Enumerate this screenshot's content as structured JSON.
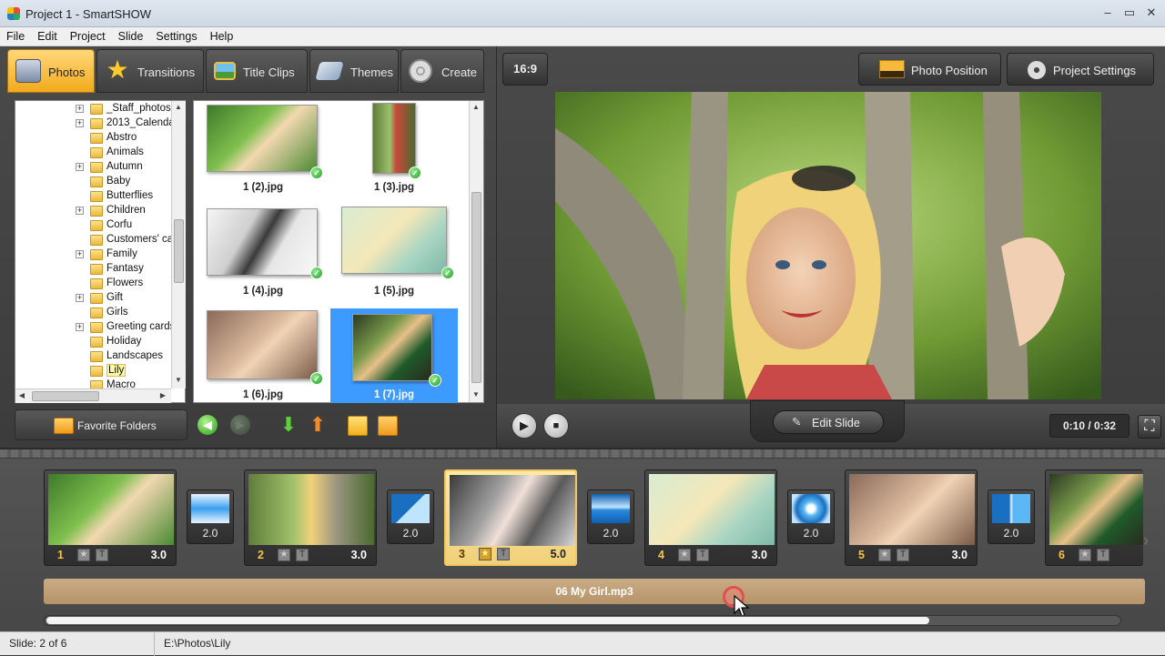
{
  "window": {
    "title": "Project 1 - SmartSHOW",
    "controls": [
      "–",
      "▭",
      "✕"
    ]
  },
  "menu": [
    "File",
    "Edit",
    "Project",
    "Slide",
    "Settings",
    "Help"
  ],
  "tabs": [
    {
      "label": "Photos",
      "icon": "camera-icon",
      "active": true
    },
    {
      "label": "Transitions",
      "icon": "star-icon",
      "active": false
    },
    {
      "label": "Title Clips",
      "icon": "picture-icon",
      "active": false
    },
    {
      "label": "Themes",
      "icon": "themes-icon",
      "active": false
    },
    {
      "label": "Create",
      "icon": "film-reel-icon",
      "active": false
    }
  ],
  "folders": [
    {
      "name": "_Staff_photos",
      "expandable": true
    },
    {
      "name": "2013_Calenda",
      "expandable": true
    },
    {
      "name": "Abstro",
      "expandable": false
    },
    {
      "name": "Animals",
      "expandable": false
    },
    {
      "name": "Autumn",
      "expandable": true
    },
    {
      "name": "Baby",
      "expandable": false
    },
    {
      "name": "Butterflies",
      "expandable": false
    },
    {
      "name": "Children",
      "expandable": true
    },
    {
      "name": "Corfu",
      "expandable": false
    },
    {
      "name": "Customers' cal",
      "expandable": false
    },
    {
      "name": "Family",
      "expandable": true
    },
    {
      "name": "Fantasy",
      "expandable": false
    },
    {
      "name": "Flowers",
      "expandable": false
    },
    {
      "name": "Gift",
      "expandable": true
    },
    {
      "name": "Girls",
      "expandable": false
    },
    {
      "name": "Greeting cards",
      "expandable": true
    },
    {
      "name": "Holiday",
      "expandable": false
    },
    {
      "name": "Landscapes",
      "expandable": false
    },
    {
      "name": "Lily",
      "expandable": false,
      "selected": true
    },
    {
      "name": "Macro",
      "expandable": false
    }
  ],
  "photos": [
    {
      "name": "1 (2).jpg",
      "used": true
    },
    {
      "name": "1 (3).jpg",
      "used": true
    },
    {
      "name": "1 (4).jpg",
      "used": true
    },
    {
      "name": "1 (5).jpg",
      "used": true
    },
    {
      "name": "1 (6).jpg",
      "used": true
    },
    {
      "name": "1 (7).jpg",
      "used": true,
      "selected": true
    }
  ],
  "favorite_folders_label": "Favorite Folders",
  "aspect_ratio": "16:9",
  "photo_position_label": "Photo Position",
  "project_settings_label": "Project Settings",
  "edit_slide_label": "Edit Slide",
  "time_display": "0:10 / 0:32",
  "slides": [
    {
      "num": "1",
      "duration": "3.0",
      "active": false
    },
    {
      "num": "2",
      "duration": "3.0",
      "active": false
    },
    {
      "num": "3",
      "duration": "5.0",
      "active": true
    },
    {
      "num": "4",
      "duration": "3.0",
      "active": false
    },
    {
      "num": "5",
      "duration": "3.0",
      "active": false
    },
    {
      "num": "6",
      "duration": "",
      "active": false
    }
  ],
  "transitions": [
    "2.0",
    "2.0",
    "2.0",
    "2.0",
    "2.0"
  ],
  "audio_track": "06 My Girl.mp3",
  "status": {
    "slide": "Slide: 2 of 6",
    "path": "E:\\Photos\\Lily"
  },
  "colors": {
    "accent": "#f2a91b",
    "selection": "#3d9bff",
    "audio": "#c1a078"
  }
}
